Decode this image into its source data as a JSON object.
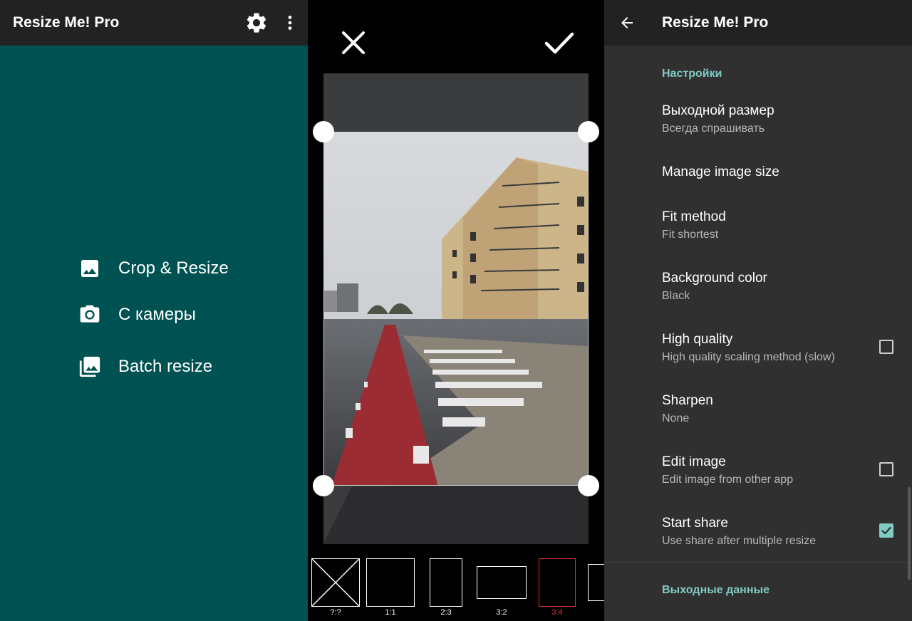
{
  "left": {
    "title": "Resize Me! Pro",
    "icons": {
      "settings": "gear-icon",
      "overflow": "more-vert-icon"
    },
    "menu": [
      {
        "icon": "image-icon",
        "label": "Crop & Resize"
      },
      {
        "icon": "camera-icon",
        "label": "С камеры"
      },
      {
        "icon": "photo-library-icon",
        "label": "Batch resize"
      }
    ],
    "colors": {
      "background": "#005252",
      "appbar": "#222222"
    }
  },
  "crop": {
    "icons": {
      "cancel": "close-icon",
      "confirm": "check-icon"
    },
    "ratios": [
      {
        "label": "?:?",
        "selected": false
      },
      {
        "label": "1:1",
        "selected": false
      },
      {
        "label": "2:3",
        "selected": false
      },
      {
        "label": "3:2",
        "selected": false
      },
      {
        "label": "3:4",
        "selected": true
      },
      {
        "label": "",
        "selected": false
      }
    ],
    "colors": {
      "selected": "#e0312e"
    }
  },
  "settings": {
    "title": "Resize Me! Pro",
    "back_icon": "arrow-back-icon",
    "section_title": "Настройки",
    "prefs": [
      {
        "title": "Выходной размер",
        "summary": "Всегда спрашивать"
      },
      {
        "title": "Manage image size",
        "summary": ""
      },
      {
        "title": "Fit method",
        "summary": "Fit shortest"
      },
      {
        "title": "Background color",
        "summary": "Black"
      },
      {
        "title": "High quality",
        "summary": "High quality scaling method (slow)",
        "checked": false
      },
      {
        "title": "Sharpen",
        "summary": "None"
      },
      {
        "title": "Edit image",
        "summary": "Edit image from other app",
        "checked": false
      },
      {
        "title": "Start share",
        "summary": "Use share after multiple resize",
        "checked": true
      }
    ],
    "section2_title": "Выходные данные",
    "colors": {
      "accent": "#80cbc4",
      "background": "#303030"
    }
  }
}
